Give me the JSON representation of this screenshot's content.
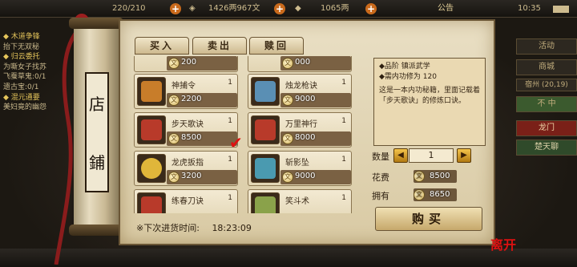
{
  "topbar": {
    "stamina": "220/210",
    "money": "1426两967文",
    "gold": "1065两",
    "notice": "公告",
    "time": "10:35"
  },
  "quests": [
    {
      "title": "◆ 木道争锋",
      "desc": "抬下无双秘"
    },
    {
      "title": "◆ 归云委托",
      "desc": "为嘶女子找苏",
      "desc2": "飞蚕草鬼:0/1",
      "desc3": "遗古宝:0/1"
    },
    {
      "title": "◆ 混元通要",
      "desc": "美妇竟的幽怨"
    }
  ],
  "rightmenu": [
    "活动",
    "商城",
    "宿州 (20,19)",
    "不 中",
    "龙门",
    "楚天聊"
  ],
  "shop": {
    "sign": [
      "店",
      "鋪"
    ],
    "tabs": [
      "买入",
      "卖出",
      "赎回"
    ],
    "items": [
      {
        "price": "200"
      },
      {
        "price": "000"
      },
      {
        "name": "神捕令",
        "qty": "1",
        "price": "2200"
      },
      {
        "name": "烛龙枪诀",
        "qty": "1",
        "price": "9000"
      },
      {
        "name": "步天歌诀",
        "qty": "1",
        "price": "8500"
      },
      {
        "name": "万里神行",
        "qty": "1",
        "price": "8000"
      },
      {
        "name": "龙虎扳指",
        "qty": "1",
        "price": "3200"
      },
      {
        "name": "斩影坠",
        "qty": "1",
        "price": "9000"
      },
      {
        "name": "练春刀诀",
        "qty": "1"
      },
      {
        "name": "笑斗术",
        "qty": "1"
      }
    ],
    "restock_label": "※下次进货时间:",
    "restock_time": "18:23:09",
    "close_seal": "离开"
  },
  "detail": {
    "grade": "◆品阶 镇派武学",
    "requirement": "◆需内功修为 120",
    "description": "这是一本内功秘籍，里面记载着「步天歌诀」的修炼口诀。"
  },
  "purchase": {
    "quantity_label": "数量",
    "quantity": "1",
    "cost_label": "花费",
    "cost": "8500",
    "owned_label": "拥有",
    "owned": "8650",
    "buy_label": "购买"
  },
  "colors": {
    "accent": "#c96a1c",
    "panel": "#e9dfc4",
    "price_bar": "#7a6143",
    "check": "#d11111"
  }
}
